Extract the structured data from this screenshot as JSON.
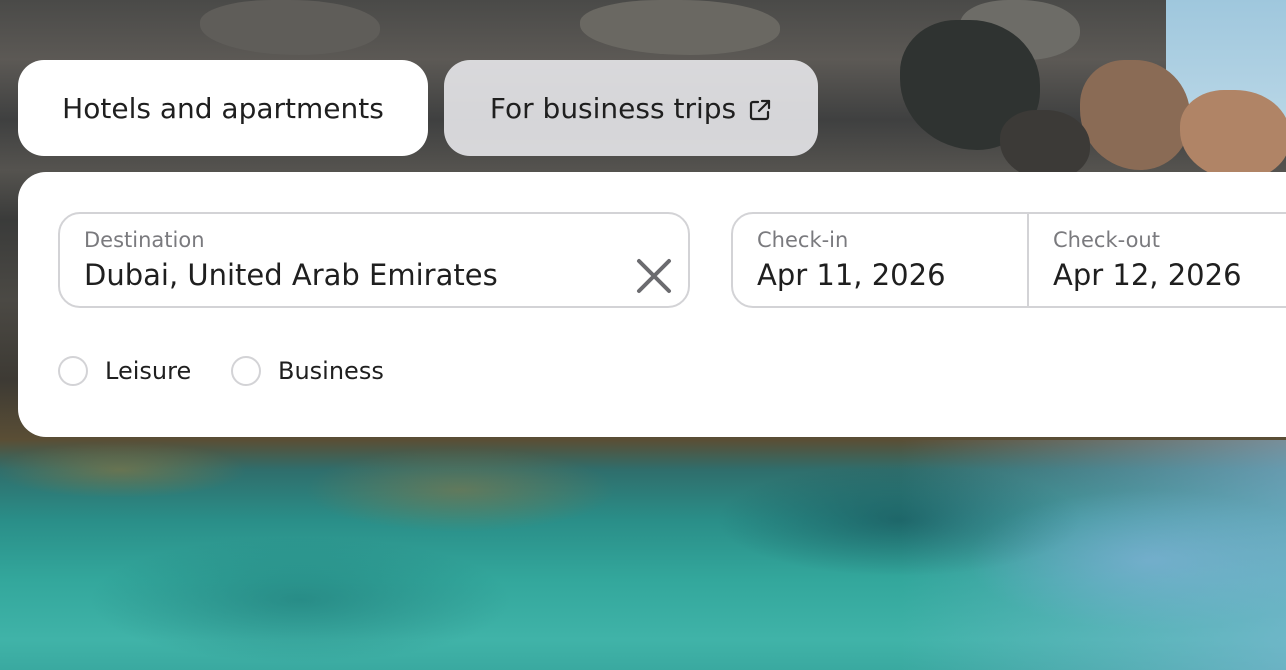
{
  "tabs": {
    "hotels_label": "Hotels and apartments",
    "business_label": "For business trips",
    "business_icon": "external-link-icon"
  },
  "search": {
    "destination": {
      "label": "Destination",
      "value": "Dubai, United Arab Emirates",
      "clear_icon": "close-icon"
    },
    "check_in": {
      "label": "Check-in",
      "value": "Apr 11, 2026"
    },
    "check_out": {
      "label": "Check-out",
      "value": "Apr 12, 2026"
    },
    "trip_type": {
      "options": [
        "Leisure",
        "Business"
      ]
    }
  },
  "colors": {
    "panel_bg": "#ffffff",
    "border": "#d3d3d6",
    "label": "#7a7a7e",
    "text": "#1f1f1f"
  }
}
